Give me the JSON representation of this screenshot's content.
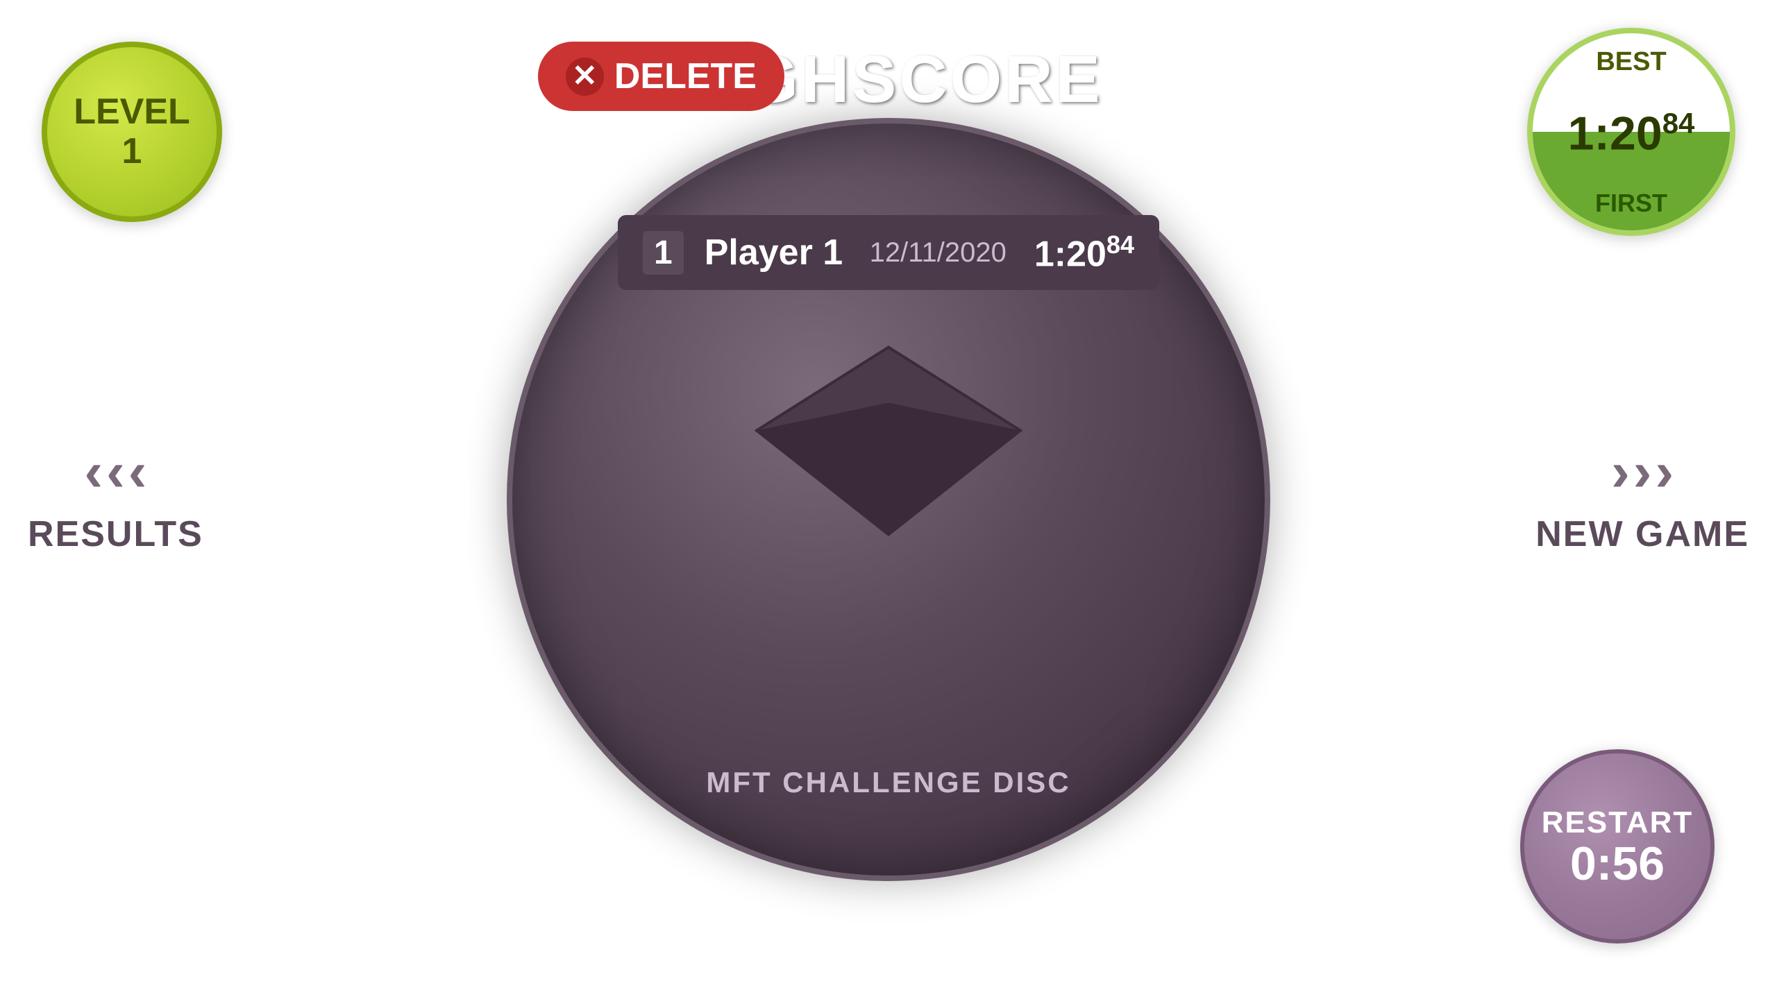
{
  "title": "HIGHSCORE",
  "delete_button": {
    "label": "DELETE",
    "x_symbol": "✕"
  },
  "score_entry": {
    "rank": "1",
    "player": "Player 1",
    "date": "12/11/2020",
    "time_main": "1:20",
    "time_sub": "84"
  },
  "level": {
    "line1": "LEVEL",
    "line2": "1"
  },
  "best": {
    "label": "BEST",
    "time_main": "1:20",
    "time_sub": "84",
    "rank_label": "FIRST"
  },
  "restart": {
    "label": "RESTART",
    "time": "0:56"
  },
  "results_nav": {
    "label": "RESULTS"
  },
  "newgame_nav": {
    "label": "NEW GAME"
  },
  "disc_label": "MFT CHALLENGE DISC"
}
